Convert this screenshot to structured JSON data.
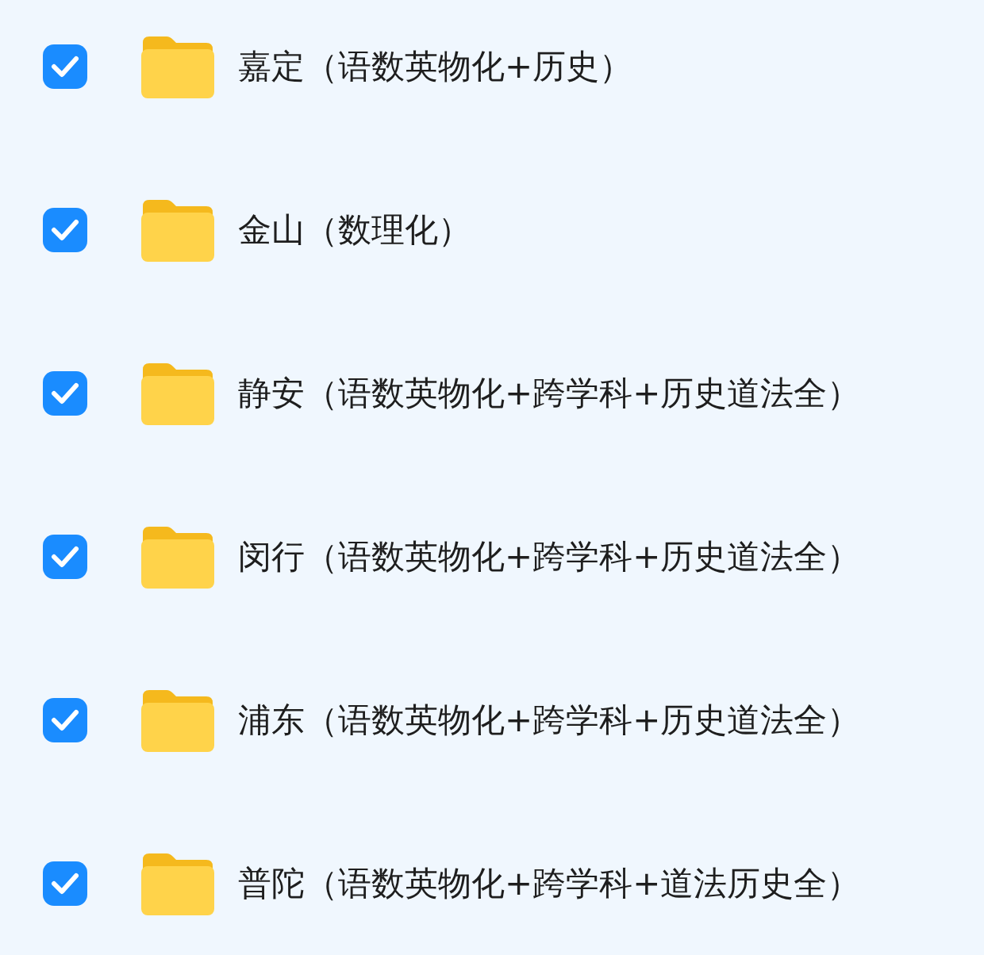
{
  "items": [
    {
      "label": "嘉定（语数英物化+历史）",
      "checked": true
    },
    {
      "label": "金山（数理化）",
      "checked": true
    },
    {
      "label": "静安（语数英物化+跨学科+历史道法全）",
      "checked": true
    },
    {
      "label": "闵行（语数英物化+跨学科+历史道法全）",
      "checked": true
    },
    {
      "label": "浦东（语数英物化+跨学科+历史道法全）",
      "checked": true
    },
    {
      "label": "普陀（语数英物化+跨学科+道法历史全）",
      "checked": true
    }
  ]
}
